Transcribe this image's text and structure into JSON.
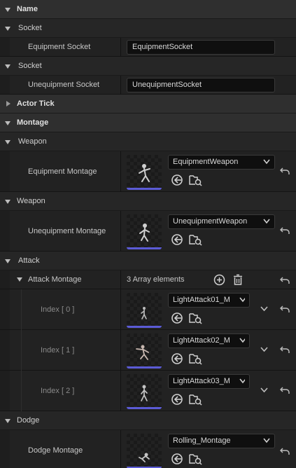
{
  "categories": {
    "name": "Name",
    "actor_tick": "Actor Tick",
    "montage": "Montage"
  },
  "socket_equip": {
    "header": "Socket",
    "label": "Equipment Socket",
    "value": "EquipmentSocket"
  },
  "socket_unequip": {
    "header": "Socket",
    "label": "Unequipment Socket",
    "value": "UnequipmentSocket"
  },
  "weapon_equip": {
    "header": "Weapon",
    "label": "Equipment Montage",
    "value": "EquipmentWeapon"
  },
  "weapon_unequip": {
    "header": "Weapon",
    "label": "Unequipment Montage",
    "value": "UnequipmentWeapon"
  },
  "attack": {
    "header": "Attack",
    "array_label": "Attack Montage",
    "count_text": "3 Array elements",
    "items": [
      {
        "index_label": "Index [ 0 ]",
        "value": "LightAttack01_M"
      },
      {
        "index_label": "Index [ 1 ]",
        "value": "LightAttack02_M"
      },
      {
        "index_label": "Index [ 2 ]",
        "value": "LightAttack03_M"
      }
    ]
  },
  "dodge": {
    "header": "Dodge",
    "label": "Dodge Montage",
    "value": "Rolling_Montage"
  },
  "icons": {
    "expand": "chevron-down-icon",
    "collapse": "chevron-right-icon",
    "reset": "reset-arrow-icon",
    "browse": "browse-asset-icon",
    "use_selected": "use-selected-icon",
    "add": "add-element-icon",
    "delete": "delete-all-icon"
  },
  "colors": {
    "thumbnail_bar": "#5b5bd6",
    "panel_bg": "#151515",
    "category_bg": "#2f2f2f"
  }
}
